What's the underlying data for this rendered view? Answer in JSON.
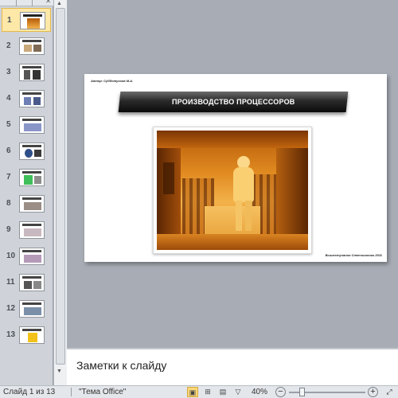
{
  "thumbnails": [
    {
      "number": "1",
      "selected": true
    },
    {
      "number": "2",
      "selected": false
    },
    {
      "number": "3",
      "selected": false
    },
    {
      "number": "4",
      "selected": false
    },
    {
      "number": "5",
      "selected": false
    },
    {
      "number": "6",
      "selected": false
    },
    {
      "number": "7",
      "selected": false
    },
    {
      "number": "8",
      "selected": false
    },
    {
      "number": "9",
      "selected": false
    },
    {
      "number": "10",
      "selected": false
    },
    {
      "number": "11",
      "selected": false
    },
    {
      "number": "12",
      "selected": false
    },
    {
      "number": "13",
      "selected": false
    }
  ],
  "slide": {
    "author": "Автор: Субботусова М.А.",
    "title": "ПРОИЗВОДСТВО ПРОЦЕССОРОВ",
    "footer": "Вышестучания Степчишники 2011",
    "image": "cleanroom-photo"
  },
  "notes": {
    "placeholder": "Заметки к слайду"
  },
  "status": {
    "slide_position": "Слайд 1 из 13",
    "theme": "\"Тема Office\"",
    "zoom": "40%",
    "zoom_level_percent": 40
  },
  "colors": {
    "selected_thumb": "#fde8a8",
    "active_view": "#fbd87a",
    "workspace": "#a8adb5"
  },
  "icons": {
    "close": "close-icon",
    "normal_view": "normal-view-icon",
    "slide_sorter": "slide-sorter-icon",
    "reading_view": "reading-view-icon",
    "slideshow": "slideshow-icon",
    "fit": "fit-to-window-icon"
  }
}
